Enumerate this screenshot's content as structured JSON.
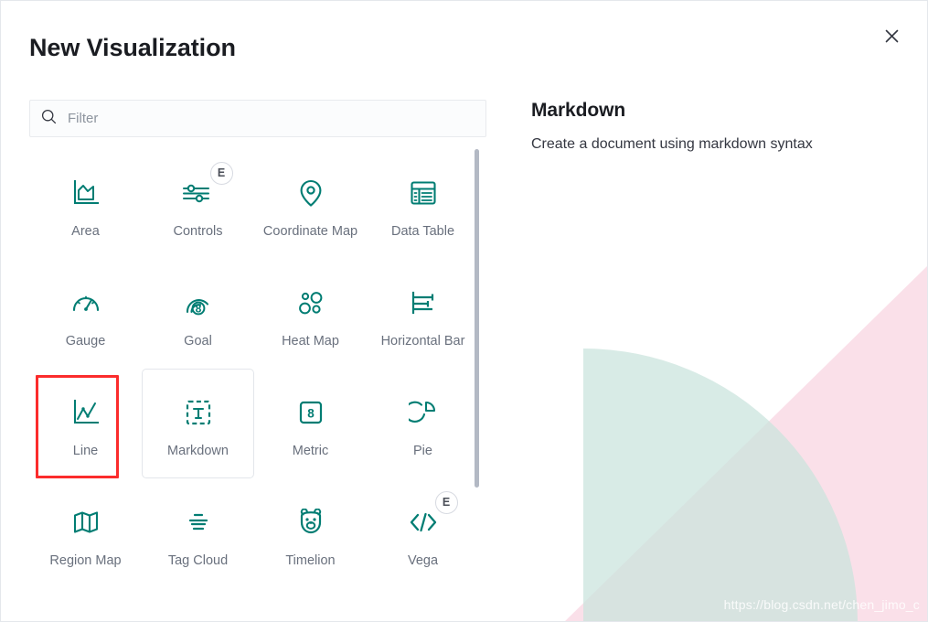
{
  "modal": {
    "title": "New Visualization",
    "close_label": "×",
    "close_icon": "close-icon"
  },
  "search": {
    "placeholder": "Filter",
    "value": "",
    "icon": "search-icon"
  },
  "grid": {
    "items": [
      {
        "label": "Area",
        "icon": "area-chart-icon",
        "badge": "",
        "state": "normal"
      },
      {
        "label": "Controls",
        "icon": "sliders-icon",
        "badge": "E",
        "state": "normal"
      },
      {
        "label": "Coordinate Map",
        "icon": "map-pin-icon",
        "badge": "",
        "state": "normal"
      },
      {
        "label": "Data Table",
        "icon": "table-icon",
        "badge": "",
        "state": "normal"
      },
      {
        "label": "Gauge",
        "icon": "gauge-icon",
        "badge": "",
        "state": "normal"
      },
      {
        "label": "Goal",
        "icon": "goal-icon",
        "badge": "",
        "state": "normal"
      },
      {
        "label": "Heat Map",
        "icon": "heat-map-icon",
        "badge": "",
        "state": "normal"
      },
      {
        "label": "Horizontal Bar",
        "icon": "horizontal-bar-icon",
        "badge": "",
        "state": "normal"
      },
      {
        "label": "Line",
        "icon": "line-chart-icon",
        "badge": "",
        "state": "highlighted"
      },
      {
        "label": "Markdown",
        "icon": "markdown-text-icon",
        "badge": "",
        "state": "hovered"
      },
      {
        "label": "Metric",
        "icon": "metric-icon",
        "badge": "",
        "state": "normal"
      },
      {
        "label": "Pie",
        "icon": "pie-chart-icon",
        "badge": "",
        "state": "normal"
      },
      {
        "label": "Region Map",
        "icon": "region-map-icon",
        "badge": "",
        "state": "normal"
      },
      {
        "label": "Tag Cloud",
        "icon": "tag-cloud-icon",
        "badge": "",
        "state": "normal"
      },
      {
        "label": "Timelion",
        "icon": "timelion-bear-icon",
        "badge": "",
        "state": "normal"
      },
      {
        "label": "Vega",
        "icon": "code-brackets-icon",
        "badge": "E",
        "state": "normal"
      }
    ]
  },
  "detail": {
    "title": "Markdown",
    "description": "Create a document using markdown syntax"
  },
  "watermark": {
    "text": "https://blog.csdn.net/chen_jimo_c"
  },
  "colors": {
    "accent_teal": "#017d73",
    "highlight_red": "#fb2c2c",
    "label_gray": "#69707d",
    "deco_pink": "#f8d7e3",
    "deco_teal": "#c9e3dd"
  }
}
